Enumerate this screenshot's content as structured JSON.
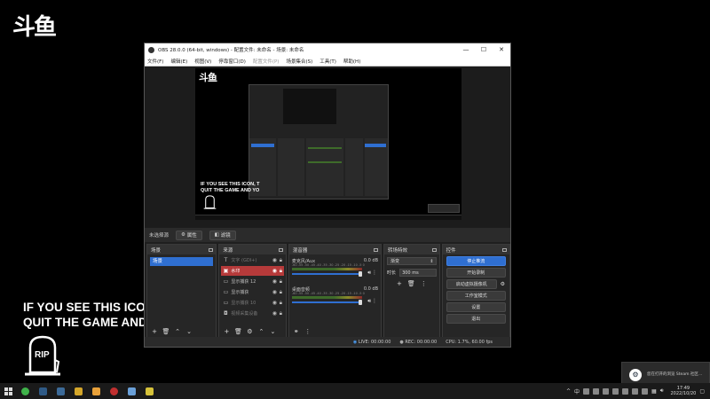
{
  "overlay": {
    "logo": "斗鱼",
    "warning_line1": "IF YOU SEE THIS ICON, T",
    "warning_line2": "QUIT THE GAME AND YO",
    "rip": "RIP"
  },
  "obs": {
    "title": "OBS 28.0.0 (64-bit, windows) - 配置文件: 未命名 - 场景: 未命名",
    "window_buttons": [
      "—",
      "☐",
      "✕"
    ],
    "menu": [
      "文件(F)",
      "编辑(E)",
      "视图(V)",
      "停靠窗口(D)",
      "配置文件(P)",
      "场景集合(S)",
      "工具(T)",
      "帮助(H)"
    ],
    "preview": {
      "logo": "斗鱼",
      "warning_line1": "IF YOU SEE THIS ICON, T",
      "warning_line2": "QUIT THE GAME AND YO"
    },
    "scene_bar": {
      "no_source": "未选择源",
      "properties": "属性",
      "filters": "滤镜"
    },
    "docks": {
      "scenes": {
        "title": "场景",
        "items": [
          "场景"
        ]
      },
      "sources": {
        "title": "来源",
        "items": [
          {
            "label": "文字 (GDI+)",
            "hidden": true,
            "selected": false
          },
          {
            "label": "水印",
            "hidden": false,
            "selected": true
          },
          {
            "label": "显示捕获 12",
            "hidden": false,
            "selected": false
          },
          {
            "label": "显示捕获",
            "hidden": false,
            "selected": false
          },
          {
            "label": "显示捕获 10",
            "hidden": true,
            "selected": false
          },
          {
            "label": "视频采集设备",
            "hidden": true,
            "selected": false
          }
        ]
      },
      "mixer": {
        "title": "混音器",
        "tracks": [
          {
            "name": "麦克风/Aux",
            "db": "0.0 dB"
          },
          {
            "name": "桌面音频",
            "db": "0.0 dB"
          }
        ],
        "scale": "-60 -55 -50 -45 -40 -35 -30 -25 -20 -15 -10 -5 0"
      },
      "transitions": {
        "title": "转场特效",
        "selected": "渐变",
        "duration_label": "时长",
        "duration_value": "300 ms"
      },
      "controls": {
        "title": "控件",
        "buttons": [
          "停止推流",
          "开始录制",
          "启动虚拟摄像机",
          "工作室模式",
          "设置",
          "退出"
        ]
      }
    },
    "status": {
      "live": "LIVE: 00:00:00",
      "rec": "REC: 00:00:00",
      "cpu": "CPU: 1.7%, 60.00 fps"
    }
  },
  "toast": {
    "message": "您在打开的浏览 Steam 社区..."
  },
  "taskbar": {
    "apps": [
      {
        "name": "wechat",
        "color": "#3fb24a"
      },
      {
        "name": "steam",
        "color": "#2f5a86"
      },
      {
        "name": "steam-2",
        "color": "#3c6a98"
      },
      {
        "name": "game",
        "color": "#d4a62a"
      },
      {
        "name": "folder",
        "color": "#e8a13a"
      },
      {
        "name": "obs",
        "color": "#c13030"
      },
      {
        "name": "app7",
        "color": "#6aa0d8"
      },
      {
        "name": "app8",
        "color": "#d6c23a"
      }
    ],
    "tray": "中",
    "time": "17:49",
    "date": "2022/10/20"
  }
}
